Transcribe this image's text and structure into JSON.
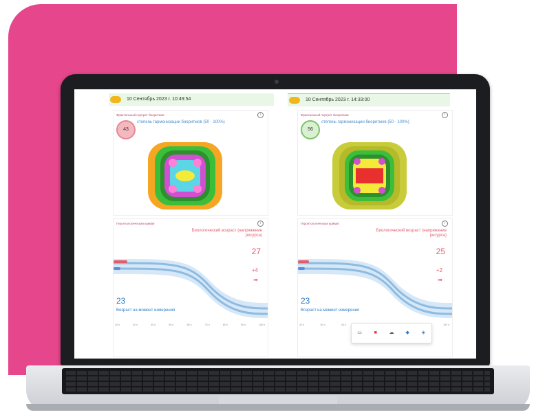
{
  "panels": [
    {
      "date": "10 Сентябрь 2023 г. 10:49:54",
      "card1_title": "Фрактальный портрет биоритмов",
      "score": "43",
      "score_text": "степень гармонизации биоритмов (50 - 100%)",
      "card2_title": "Геронтологическая кривая",
      "bio_label": "Биологический возраст (напряжение ресурса)",
      "bio_age": "27",
      "delta": "+4",
      "age": "23",
      "age_label": "Возраст на момент измерения",
      "axis_ticks": [
        "20 л",
        "30 л",
        "40 л",
        "50 л",
        "60 л",
        "70 л",
        "80 л",
        "90 л",
        "100 л"
      ]
    },
    {
      "date": "10 Сентябрь 2023 г. 14:33:00",
      "card1_title": "Фрактальный портрет биоритмов",
      "score": "56",
      "score_text": "степень гармонизации биоритмов (50 - 100%)",
      "card2_title": "Геронтологическая кривая",
      "bio_label": "Биологический возраст (напряжение ресурса)",
      "bio_age": "25",
      "delta": "+2",
      "age": "23",
      "age_label": "Возраст на момент измерения",
      "axis_ticks": [
        "20 л",
        "30 л",
        "40 л",
        "",
        "",
        "",
        "",
        "",
        "100 л"
      ]
    }
  ],
  "taskbar_icons": [
    "monitor-icon",
    "app-icon",
    "cloud-icon",
    "windows-icon",
    "shield-icon"
  ],
  "colors": {
    "pink": "#e6468b",
    "red_score": "#e48a96",
    "green_score": "#7fc06c",
    "blue_curve": "#2f7ac4"
  }
}
